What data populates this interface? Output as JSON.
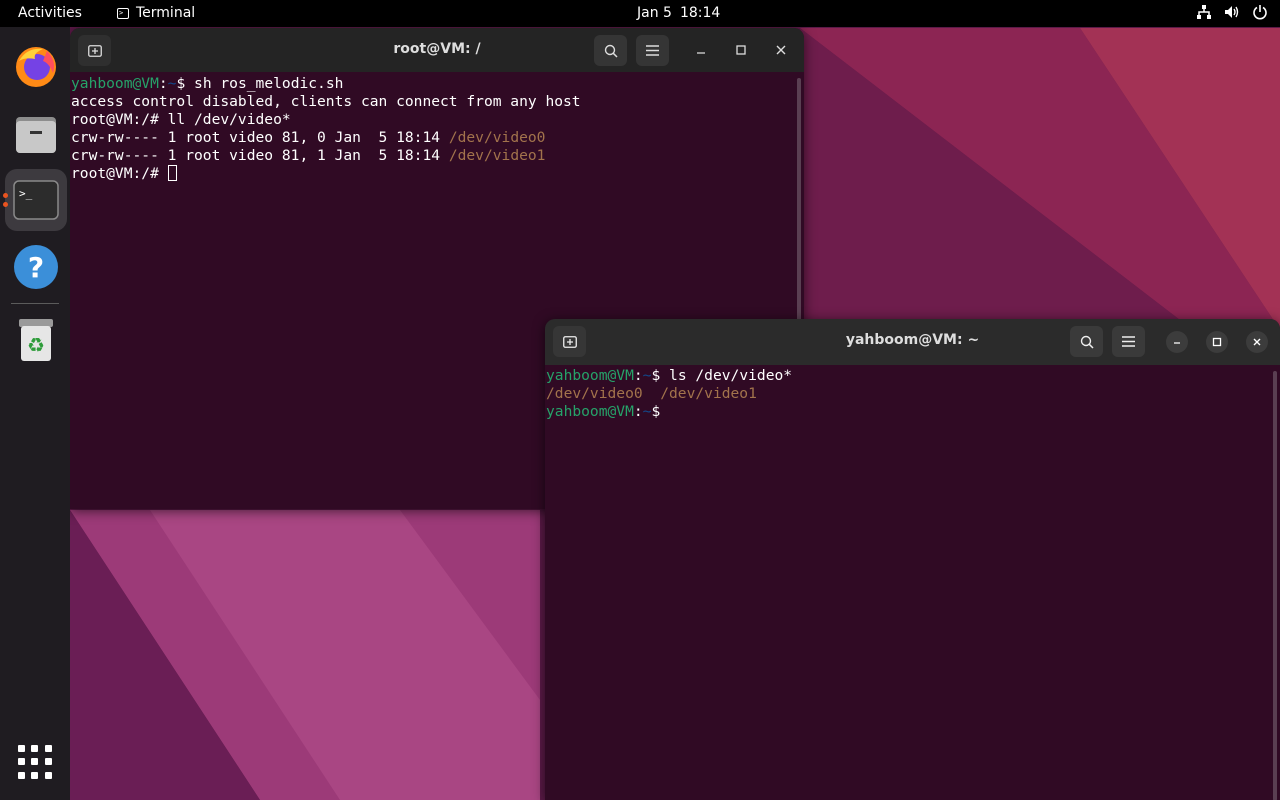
{
  "topbar": {
    "activities": "Activities",
    "app_name": "Terminal",
    "app_icon": "terminal-icon",
    "date": "Jan 5",
    "time": "18:14",
    "tray_icons": [
      "network-icon",
      "volume-icon",
      "power-icon"
    ]
  },
  "dock": {
    "items": [
      {
        "name": "firefox-icon",
        "running": false
      },
      {
        "name": "files-icon",
        "running": false
      },
      {
        "name": "terminal-icon",
        "running": true,
        "active": true
      },
      {
        "name": "help-icon",
        "running": false
      },
      {
        "name": "trash-icon",
        "running": false
      }
    ],
    "show_apps_icon": "apps-grid-icon"
  },
  "windows": [
    {
      "title": "root@VM: /",
      "lines": [
        {
          "segments": [
            {
              "t": "yahboom@VM",
              "c": "u"
            },
            {
              "t": ":",
              "c": ""
            },
            {
              "t": "~",
              "c": "p"
            },
            {
              "t": "$ sh ros_melodic.sh",
              "c": ""
            }
          ]
        },
        {
          "segments": [
            {
              "t": "access control disabled, clients can connect from any host",
              "c": ""
            }
          ]
        },
        {
          "segments": [
            {
              "t": "root@VM:/# ll /dev/video*",
              "c": ""
            }
          ]
        },
        {
          "segments": [
            {
              "t": "crw-rw---- 1 root video 81, 0 Jan  5 18:14 ",
              "c": ""
            },
            {
              "t": "/dev/video0",
              "c": "d"
            }
          ]
        },
        {
          "segments": [
            {
              "t": "crw-rw---- 1 root video 81, 1 Jan  5 18:14 ",
              "c": ""
            },
            {
              "t": "/dev/video1",
              "c": "d"
            }
          ]
        },
        {
          "segments": [
            {
              "t": "root@VM:/# ",
              "c": ""
            }
          ],
          "cursor": true
        }
      ]
    },
    {
      "title": "yahboom@VM: ~",
      "lines": [
        {
          "segments": [
            {
              "t": "yahboom@VM",
              "c": "u"
            },
            {
              "t": ":",
              "c": ""
            },
            {
              "t": "~",
              "c": "p"
            },
            {
              "t": "$ ls /dev/video*",
              "c": ""
            }
          ]
        },
        {
          "segments": [
            {
              "t": "/dev/video0",
              "c": "d"
            },
            {
              "t": "  ",
              "c": ""
            },
            {
              "t": "/dev/video1",
              "c": "d"
            }
          ]
        },
        {
          "segments": [
            {
              "t": "yahboom@VM",
              "c": "u"
            },
            {
              "t": ":",
              "c": ""
            },
            {
              "t": "~",
              "c": "p"
            },
            {
              "t": "$",
              "c": ""
            }
          ]
        }
      ]
    }
  ],
  "colors": {
    "terminal_bg": "#300a24",
    "prompt_user": "#26a269",
    "prompt_path": "#12488b",
    "device_file": "#a2734c",
    "accent": "#e95420"
  }
}
